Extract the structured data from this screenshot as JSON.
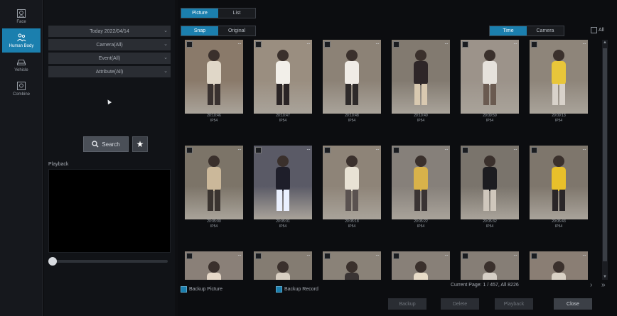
{
  "nav": [
    {
      "label": "Face",
      "icon": "face-icon",
      "active": false
    },
    {
      "label": "Human Body",
      "icon": "human-body-icon",
      "active": true
    },
    {
      "label": "Vehicle",
      "icon": "vehicle-icon",
      "active": false
    },
    {
      "label": "Combine",
      "icon": "combine-icon",
      "active": false
    }
  ],
  "filters": {
    "date": "Today 2022/04/14",
    "camera": "Camera(All)",
    "event": "Event(All)",
    "attribute": "Attribute(All)"
  },
  "search_label": "Search",
  "playback_label": "Playback",
  "view_tabs": [
    {
      "label": "Picture",
      "active": true
    },
    {
      "label": "List",
      "active": false
    }
  ],
  "image_tabs": [
    {
      "label": "Snap",
      "active": true
    },
    {
      "label": "Original",
      "active": false
    }
  ],
  "sort_tabs": [
    {
      "label": "Time",
      "active": true
    },
    {
      "label": "Camera",
      "active": false
    }
  ],
  "all_label": "All",
  "results": [
    {
      "time": "20:10:46",
      "camera": "IP54"
    },
    {
      "time": "20:10:47",
      "camera": "IP54"
    },
    {
      "time": "20:10:48",
      "camera": "IP54"
    },
    {
      "time": "20:10:49",
      "camera": "IP54"
    },
    {
      "time": "20:09:59",
      "camera": "IP54"
    },
    {
      "time": "20:09:13",
      "camera": "IP54"
    },
    {
      "time": "20:05:00",
      "camera": "IP54"
    },
    {
      "time": "20:05:01",
      "camera": "IP54"
    },
    {
      "time": "20:05:18",
      "camera": "IP54"
    },
    {
      "time": "20:05:22",
      "camera": "IP54"
    },
    {
      "time": "20:05:32",
      "camera": "IP54"
    },
    {
      "time": "20:05:43",
      "camera": "IP54"
    },
    {
      "time": "",
      "camera": ""
    },
    {
      "time": "",
      "camera": ""
    },
    {
      "time": "",
      "camera": ""
    },
    {
      "time": "",
      "camera": ""
    },
    {
      "time": "",
      "camera": ""
    },
    {
      "time": "",
      "camera": ""
    }
  ],
  "backup_picture_label": "Backup Picture",
  "backup_record_label": "Backup Record",
  "page_info": "Current Page: 1 / 457, All 8226",
  "buttons": {
    "backup": "Backup",
    "delete": "Delete",
    "playback": "Playback",
    "close": "Close"
  },
  "colors": {
    "accent": "#1b7fae"
  }
}
